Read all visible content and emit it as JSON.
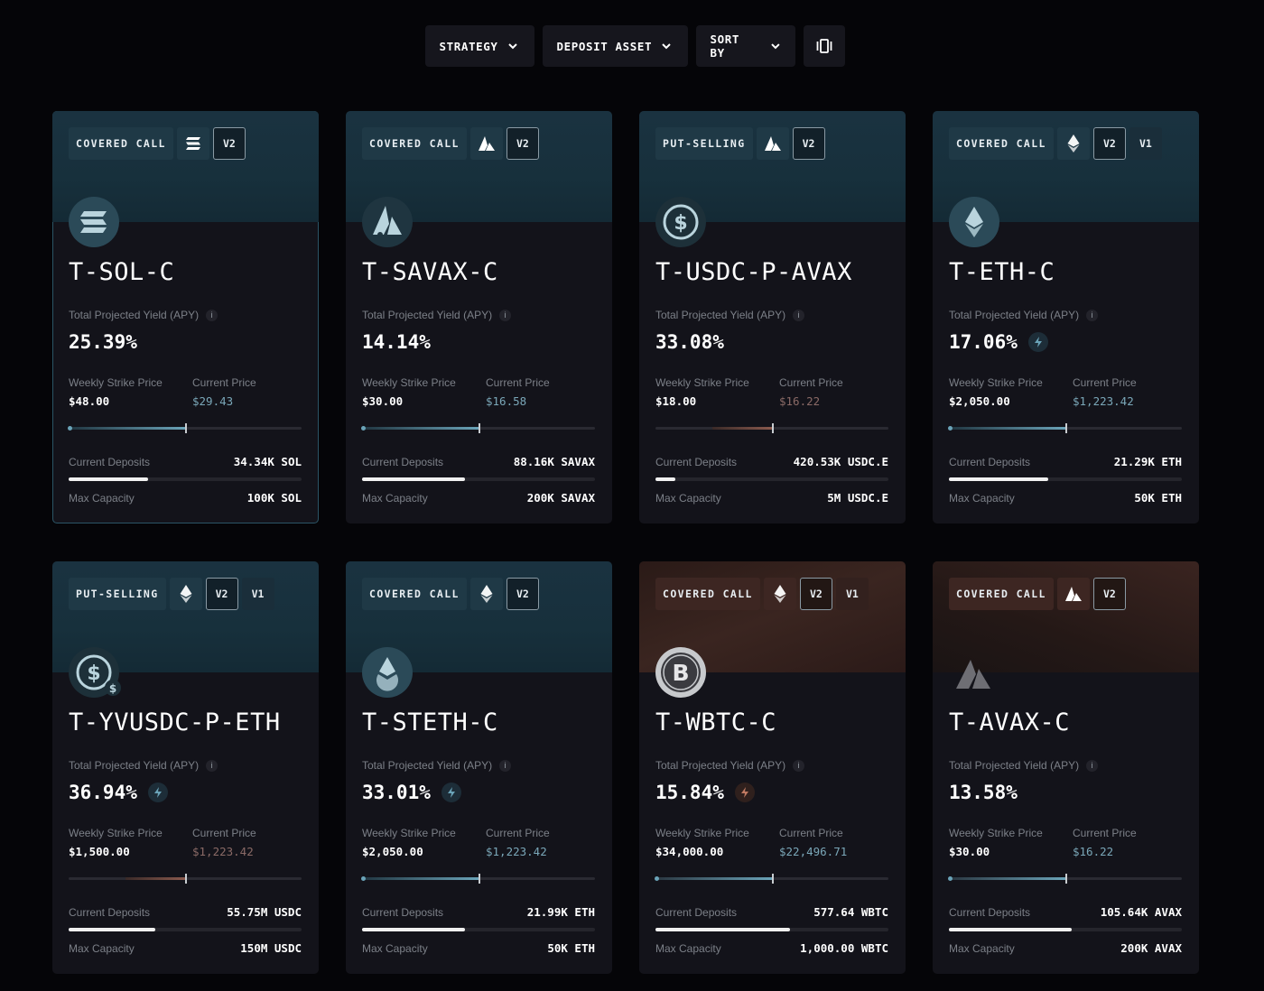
{
  "filters": {
    "strategy": "STRATEGY",
    "deposit_asset": "DEPOSIT ASSET",
    "sort_by": "SORT BY",
    "view_toggle_icon": "view-toggle-icon"
  },
  "labels": {
    "apy": "Total Projected Yield (APY)",
    "weekly_strike": "Weekly Strike Price",
    "current_price": "Current Price",
    "current_deposits": "Current Deposits",
    "max_capacity": "Max Capacity",
    "info": "i"
  },
  "colors": {
    "background": "#050508",
    "card": "#13131a",
    "accent_blue": "#6aa3b8",
    "accent_orange": "#c07a62",
    "tag_blue": "#1f3946",
    "tag_orange": "#3d2622"
  },
  "vaults": [
    {
      "strategy": "COVERED CALL",
      "chain_icon": "solana-icon",
      "versions": [
        "V2"
      ],
      "active_version": "V2",
      "asset_icon": "solana-coin-icon",
      "name": "T-SOL-C",
      "apy": "25.39%",
      "apy_boost": false,
      "strike_price": "$48.00",
      "current_price": "$29.43",
      "current_price_below_strike": true,
      "strike_position": 0.5,
      "current_position": 0.5,
      "deposits": "34.34K SOL",
      "deposit_ratio": 0.3434,
      "capacity": "100K SOL",
      "theme": "blue",
      "selected": true
    },
    {
      "strategy": "COVERED CALL",
      "chain_icon": "avalanche-icon",
      "versions": [
        "V2"
      ],
      "active_version": "V2",
      "asset_icon": "savax-coin-icon",
      "name": "T-SAVAX-C",
      "apy": "14.14%",
      "apy_boost": false,
      "strike_price": "$30.00",
      "current_price": "$16.58",
      "strike_position": 0.5,
      "deposits": "88.16K SAVAX",
      "deposit_ratio": 0.4408,
      "capacity": "200K SAVAX",
      "theme": "blue",
      "selected": false
    },
    {
      "strategy": "PUT-SELLING",
      "chain_icon": "avalanche-icon",
      "versions": [
        "V2"
      ],
      "active_version": "V2",
      "asset_icon": "usdc-coin-icon",
      "name": "T-USDC-P-AVAX",
      "apy": "33.08%",
      "apy_boost": false,
      "strike_price": "$18.00",
      "current_price": "$16.22",
      "current_red": true,
      "strike_position": 0.5,
      "deposits": "420.53K USDC.E",
      "deposit_ratio": 0.0841,
      "capacity": "5M USDC.E",
      "theme": "blue",
      "selected": false
    },
    {
      "strategy": "COVERED CALL",
      "chain_icon": "ethereum-icon",
      "versions": [
        "V2",
        "V1"
      ],
      "active_version": "V2",
      "asset_icon": "ethereum-coin-icon",
      "name": "T-ETH-C",
      "apy": "17.06%",
      "apy_boost": true,
      "strike_price": "$2,050.00",
      "current_price": "$1,223.42",
      "strike_position": 0.5,
      "deposits": "21.29K ETH",
      "deposit_ratio": 0.4258,
      "capacity": "50K ETH",
      "theme": "blue",
      "selected": false
    },
    {
      "strategy": "PUT-SELLING",
      "chain_icon": "ethereum-icon",
      "versions": [
        "V2",
        "V1"
      ],
      "active_version": "V2",
      "asset_icon": "yvusdc-coin-icon",
      "name": "T-YVUSDC-P-ETH",
      "apy": "36.94%",
      "apy_boost": true,
      "strike_price": "$1,500.00",
      "current_price": "$1,223.42",
      "current_red": true,
      "strike_position": 0.5,
      "deposits": "55.75M USDC",
      "deposit_ratio": 0.3717,
      "capacity": "150M USDC",
      "theme": "blue",
      "selected": false
    },
    {
      "strategy": "COVERED CALL",
      "chain_icon": "ethereum-icon",
      "versions": [
        "V2"
      ],
      "active_version": "V2",
      "asset_icon": "steth-coin-icon",
      "name": "T-STETH-C",
      "apy": "33.01%",
      "apy_boost": true,
      "strike_price": "$2,050.00",
      "current_price": "$1,223.42",
      "strike_position": 0.5,
      "deposits": "21.99K ETH",
      "deposit_ratio": 0.4398,
      "capacity": "50K ETH",
      "theme": "blue",
      "selected": false
    },
    {
      "strategy": "COVERED CALL",
      "chain_icon": "ethereum-icon",
      "versions": [
        "V2",
        "V1"
      ],
      "active_version": "V2",
      "asset_icon": "wbtc-coin-icon",
      "name": "T-WBTC-C",
      "apy": "15.84%",
      "apy_boost": true,
      "strike_price": "$34,000.00",
      "current_price": "$22,496.71",
      "strike_position": 0.5,
      "deposits": "577.64 WBTC",
      "deposit_ratio": 0.5776,
      "capacity": "1,000.00 WBTC",
      "theme": "orange",
      "selected": false
    },
    {
      "strategy": "COVERED CALL",
      "chain_icon": "avalanche-icon",
      "versions": [
        "V2"
      ],
      "active_version": "V2",
      "asset_icon": "avax-coin-icon",
      "name": "T-AVAX-C",
      "apy": "13.58%",
      "apy_boost": false,
      "strike_price": "$30.00",
      "current_price": "$16.22",
      "strike_position": 0.5,
      "deposits": "105.64K AVAX",
      "deposit_ratio": 0.5282,
      "capacity": "200K AVAX",
      "theme": "brown",
      "selected": false
    }
  ]
}
